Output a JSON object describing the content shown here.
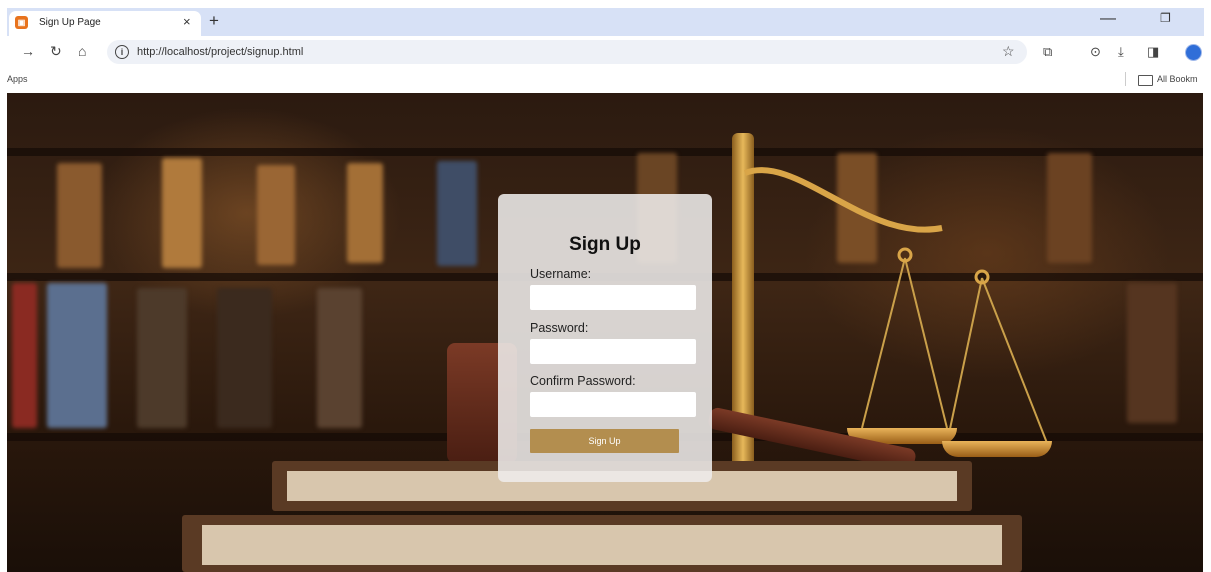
{
  "browser": {
    "tab_title": "Sign Up Page",
    "tab_close": "×",
    "new_tab": "+",
    "url": "http://localhost/project/signup.html",
    "bookmarks_left": "Apps",
    "bookmarks_right": "All Bookm",
    "favicon": "page-icon",
    "minimize": "—",
    "restore": "❐"
  },
  "signup": {
    "title": "Sign Up",
    "username_label": "Username:",
    "username_value": "",
    "password_label": "Password:",
    "password_value": "",
    "confirm_label": "Confirm Password:",
    "confirm_value": "",
    "submit_label": "Sign Up",
    "button_color": "#b38e4f"
  }
}
